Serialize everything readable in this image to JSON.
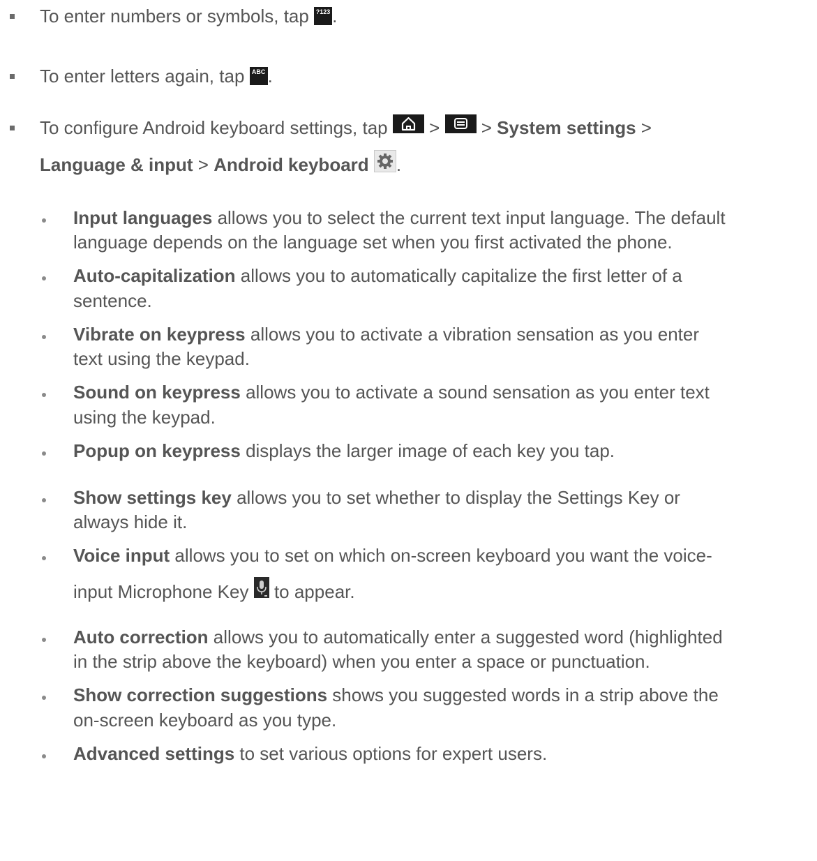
{
  "bullets": [
    {
      "text": "To enter numbers or symbols, tap ",
      "icon_label": "?123",
      "after": "."
    },
    {
      "text": "To enter letters again, tap ",
      "icon_label": "ABC",
      "after": "."
    },
    {
      "line1_pre": "To configure Android keyboard settings, tap ",
      "sep1": " > ",
      "sep2": " > ",
      "b1": "System settings",
      "sep3": " >",
      "b2": "Language & input",
      "sep4": " > ",
      "b3": "Android keyboard",
      "end": "."
    }
  ],
  "subitems": [
    {
      "bold": "Input languages",
      "l1": " allows you to select the current text input language. The default",
      "l2": "language depends on the language set when you first activated the phone."
    },
    {
      "bold": "Auto-capitalization",
      "l1": " allows you to automatically capitalize the first letter of a",
      "l2": "sentence."
    },
    {
      "bold": "Vibrate on keypress",
      "l1": " allows you to activate a vibration sensation as you enter",
      "l2": "text using the keypad."
    },
    {
      "bold": "Sound on keypress",
      "l1": " allows you to activate a sound sensation as you enter text",
      "l2": "using the keypad."
    },
    {
      "bold": "Popup on keypress",
      "l1": " displays the larger image of each key you tap.",
      "l2": ""
    },
    {
      "bold": "Show settings key",
      "l1": " allows you to set whether to display the Settings Key or",
      "l2": "always hide it."
    },
    {
      "bold": "Voice input",
      "l1": " allows you to set on which on-screen keyboard you want the voice-",
      "l2_pre": "input Microphone Key ",
      "l2_post": " to appear."
    },
    {
      "bold": "Auto correction",
      "l1": " allows you to automatically enter a suggested word (highlighted",
      "l2": "in the strip above the keyboard) when you enter a space or punctuation."
    },
    {
      "bold": "Show correction suggestions",
      "l1": " shows you suggested words in a strip above the",
      "l2": "on-screen keyboard as you type."
    },
    {
      "bold": "Advanced settings",
      "l1": " to set various options for expert users.",
      "l2": ""
    }
  ],
  "icons": {
    "home": "home-icon",
    "menu": "menu-icon",
    "gear": "gear-icon",
    "mic": "microphone-icon"
  }
}
